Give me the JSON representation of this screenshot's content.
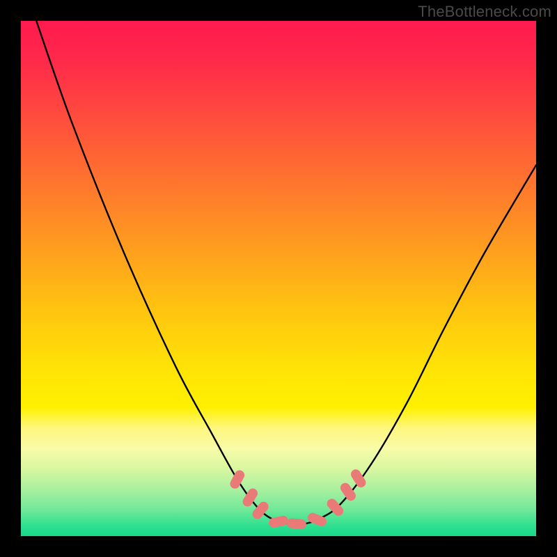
{
  "watermark": "TheBottleneck.com",
  "chart_data": {
    "type": "line",
    "title": "",
    "xlabel": "",
    "ylabel": "",
    "xlim": [
      0,
      100
    ],
    "ylim": [
      0,
      100
    ],
    "grid": false,
    "legend": false,
    "series": [
      {
        "name": "curve",
        "x": [
          3,
          10,
          20,
          30,
          37,
          42,
          46,
          49,
          52,
          55,
          58,
          62,
          68,
          75,
          82,
          90,
          100
        ],
        "values": [
          100,
          80,
          55,
          33,
          20,
          11,
          5.5,
          3.2,
          2.4,
          2.4,
          3.4,
          6.2,
          14,
          26,
          40,
          55,
          72
        ]
      }
    ],
    "markers": {
      "shape": "capsule",
      "color": "#e97a78",
      "points": [
        {
          "x": 42.0,
          "y": 11.0,
          "angle": -62
        },
        {
          "x": 44.5,
          "y": 7.5,
          "angle": -58
        },
        {
          "x": 46.5,
          "y": 5.0,
          "angle": -50
        },
        {
          "x": 50.0,
          "y": 2.8,
          "angle": -12
        },
        {
          "x": 53.5,
          "y": 2.4,
          "angle": 5
        },
        {
          "x": 57.5,
          "y": 3.2,
          "angle": 22
        },
        {
          "x": 61.0,
          "y": 5.6,
          "angle": 48
        },
        {
          "x": 63.5,
          "y": 8.6,
          "angle": 55
        },
        {
          "x": 65.5,
          "y": 11.2,
          "angle": 58
        }
      ]
    },
    "background": {
      "type": "vertical-gradient",
      "stops": [
        {
          "pos": 0.0,
          "color": "#ff1a4e"
        },
        {
          "pos": 0.48,
          "color": "#ffaa1a"
        },
        {
          "pos": 0.75,
          "color": "#fef000"
        },
        {
          "pos": 1.0,
          "color": "#18d888"
        }
      ]
    }
  }
}
